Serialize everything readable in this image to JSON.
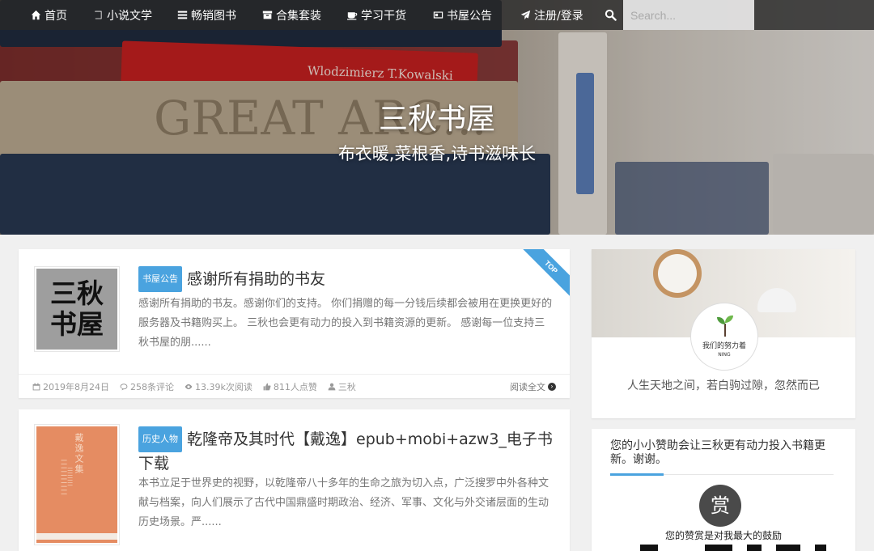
{
  "nav": {
    "items": [
      {
        "label": "首页",
        "icon": "home-icon"
      },
      {
        "label": "小说文学",
        "icon": "book-icon"
      },
      {
        "label": "畅销图书",
        "icon": "list-icon"
      },
      {
        "label": "合集套装",
        "icon": "archive-icon"
      },
      {
        "label": "学习干货",
        "icon": "coffee-icon"
      },
      {
        "label": "书屋公告",
        "icon": "card-icon"
      },
      {
        "label": "注册/登录",
        "icon": "send-icon"
      }
    ],
    "search_placeholder": "Search..."
  },
  "hero": {
    "title": "三秋书屋",
    "subtitle": "布衣暖,菜根香,诗书滋味长",
    "book_spine_texts": [
      "Wlodzimierz T.Kowalski",
      "GREAT ARC..."
    ]
  },
  "posts": [
    {
      "category": "书屋公告",
      "title": "感谢所有捐助的书友",
      "excerpt": "感谢所有捐助的书友。感谢你们的支持。 你们捐赠的每一分钱后续都会被用在更换更好的服务器及书籍购买上。 三秋也会更有动力的投入到书籍资源的更新。 感谢每一位支持三秋书屋的朋......",
      "thumb_text_1": "三秋",
      "thumb_text_2": "书屋",
      "ribbon": "TOP",
      "date": "2019年8月24日",
      "comments": "258条评论",
      "views": "13.39k次阅读",
      "likes": "811人点赞",
      "author": "三秋",
      "read_more": "阅读全文"
    },
    {
      "category": "历史人物",
      "title": "乾隆帝及其时代【戴逸】epub+mobi+azw3_电子书下载",
      "excerpt": "本书立足于世界史的视野，以乾隆帝八十多年的生命之旅为切入点，广泛搜罗中外各种文献与档案，向人们展示了古代中国鼎盛时期政治、经济、军事、文化与外交诸层面的生动历史场景。严......",
      "cover_text": "戴逸文集"
    }
  ],
  "sidebar": {
    "profile_text": "我们的努力着",
    "profile_sub": "NING",
    "motto": "人生天地之间，若白驹过隙，忽然而已",
    "reward_title": "您的小小赞助会让三秋更有动力投入书籍更新。谢谢。",
    "reward_button": "赏",
    "reward_text": "您的赞赏是对我最大的鼓励"
  },
  "colors": {
    "accent": "#4aa3df",
    "nav_bg": "#282828",
    "page_bg": "#f0f0f0"
  }
}
